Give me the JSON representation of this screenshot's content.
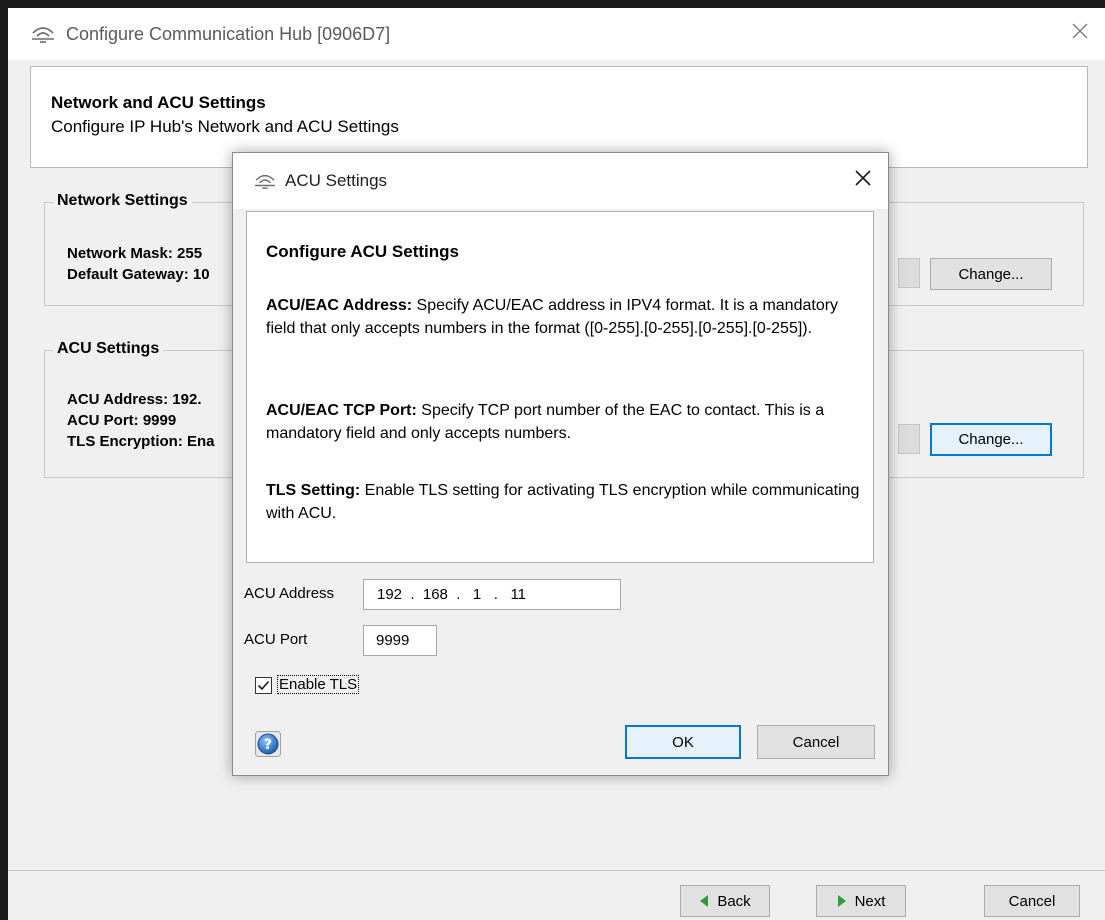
{
  "main_window": {
    "title": "Configure Communication Hub [0906D7]",
    "header": {
      "title": "Network and ACU Settings",
      "subtitle": "Configure IP Hub's Network and ACU Settings"
    },
    "network_settings": {
      "legend": "Network Settings",
      "lines": [
        "Network Mask: 255",
        "Default Gateway: 10"
      ],
      "change_label": "Change..."
    },
    "acu_settings": {
      "legend": "ACU Settings",
      "lines": [
        "ACU Address: 192.",
        "ACU Port: 9999",
        "TLS Encryption: Ena"
      ],
      "change_label": "Change..."
    },
    "footer": {
      "back_label": "Back",
      "next_label": "Next",
      "cancel_label": "Cancel"
    }
  },
  "acu_dialog": {
    "title": "ACU Settings",
    "heading": "Configure ACU Settings",
    "paragraphs": [
      {
        "term": "ACU/EAC Address:",
        "text": " Specify ACU/EAC address in IPV4 format. It is a mandatory field that only accepts numbers in the format ([0-255].[0-255].[0-255].[0-255])."
      },
      {
        "term": "ACU/EAC TCP Port:",
        "text": " Specify TCP port number of the EAC to contact. This is a mandatory field and only accepts numbers."
      },
      {
        "term": "TLS Setting:",
        "text": " Enable TLS setting for activating TLS encryption while communicating with ACU."
      }
    ],
    "address_label": "ACU Address",
    "address_octets": [
      "192",
      "168",
      "1",
      "11"
    ],
    "port_label": "ACU Port",
    "port_value": "9999",
    "tls_label": "Enable TLS",
    "tls_checked": true,
    "ok_label": "OK",
    "cancel_label": "Cancel"
  },
  "colors": {
    "accent": "#0078d7",
    "window_bg": "#f0f0f0",
    "help_icon": "#2a6ebb"
  }
}
